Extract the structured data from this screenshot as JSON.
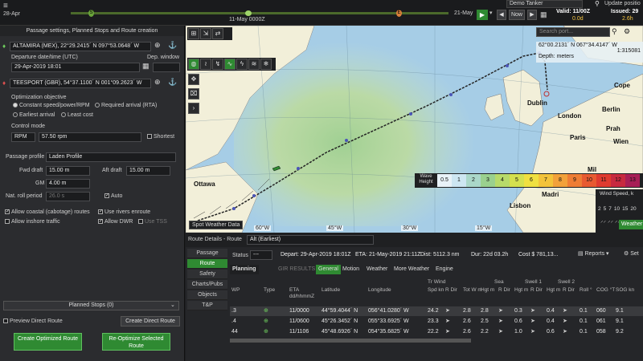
{
  "topbar": {
    "start_date": "28-Apr",
    "mid_date": "11-May 0000Z",
    "end_date": "21-May",
    "marker_start": "S",
    "marker_end": "E",
    "vessel": "Demo Tanker",
    "now_label": "Now",
    "update_label": "Update positio",
    "valid_label": "Valid: 11/00Z",
    "valid_sub": "0.0d",
    "issued_label": "Issued: 29",
    "issued_sub": "2.6h",
    "hamburger": "≡"
  },
  "left": {
    "header": "Passage settings, Planned Stops and Route creation",
    "departure_port": "ALTAMIRA (MEX), 22°29.2415´ N 097°53.0648´ W",
    "departure_label": "Departure date/time (UTC)",
    "dep_window_label": "Dep. window",
    "departure_datetime": "29-Apr-2019 18:01",
    "arrival_port": "TEESPORT (GBR), 54°37.1100´ N 001°09.2623´ W",
    "opt_label": "Optimization objective",
    "opt_constant": "Constant speed/power/RPM",
    "opt_rta": "Required arrival (RTA)",
    "opt_earliest": "Earliest arrival",
    "opt_least": "Least cost",
    "control_label": "Control mode",
    "control_mode": "RPM",
    "rpm_value": "57.50 rpm",
    "shortest": "Shortest",
    "profile_label": "Passage profile",
    "profile_value": "Laden Profile",
    "fwd_label": "Fwd draft",
    "fwd_value": "15.00 m",
    "aft_label": "Aft draft",
    "aft_value": "15.00 m",
    "gm_label": "GM",
    "gm_value": "4.00 m",
    "roll_label": "Nat. roll period",
    "roll_value": "26.0 s",
    "auto_label": "Auto",
    "cabotage": "Allow coastal (cabotage) routes",
    "rivers": "Use rivers enroute",
    "inshore": "Allow inshore traffic",
    "dwr": "Allow DWR",
    "tss": "Use TSS",
    "planned_stops": "Planned Stops (0)",
    "preview_direct": "Preview Direct Route",
    "create_direct": "Create Direct Route",
    "create_optimized": "Create Optimized Route",
    "reoptimize": "Re-Optimize Selected Route"
  },
  "map": {
    "search_placeholder": "Search port...",
    "coords": "62°00.2131´ N  067°34.4147´ W",
    "scale": "1:315081",
    "depth": "Depth: meters",
    "places": [
      "Ottawa",
      "Dublin",
      "London",
      "Berlin",
      "Paris",
      "Prah",
      "Wien",
      "Madri",
      "Lisbon",
      "Mil",
      "Cope"
    ],
    "lon_labels": [
      "60°W",
      "45°W",
      "30°W",
      "15°W"
    ],
    "spot_weather": "Spot Weather Data",
    "wave_label": "Wave Height",
    "wave_scale": [
      "0.5",
      "1",
      "2",
      "3",
      "4",
      "5",
      "6",
      "7",
      "8",
      "9",
      "10",
      "11",
      "12",
      "13"
    ],
    "wave_colors": [
      "#e8f2f8",
      "#cde6f2",
      "#aad7c9",
      "#9ad08e",
      "#b7da6a",
      "#d4e04e",
      "#f0e040",
      "#f3c33a",
      "#f2a13a",
      "#ee7d35",
      "#e85a30",
      "#df3b2f",
      "#c72a3f",
      "#a71f55"
    ],
    "wind_label": "Wind Speed, k",
    "wind_scale": [
      "2",
      "5",
      "7",
      "10",
      "15",
      "20"
    ],
    "weather_label": "Weather"
  },
  "route": {
    "title": "Route Details - Route",
    "route_name": "Alt (Earliest)",
    "status_label": "Status",
    "status_value": "---",
    "depart": "Depart: 29-Apr-2019 18:01Z",
    "eta": "ETA: 21-May-2019 21:11Z",
    "dist": "Dist: 5112.3 nm",
    "dur": "Dur: 22d 03.2h",
    "cost": "Cost $ 781,13...",
    "reports": "Reports",
    "set": "Set",
    "side_tabs": [
      "Passage",
      "Route",
      "Safety",
      "Charts/Pubs",
      "Objects",
      "T&P"
    ],
    "tabs": [
      "Planning",
      "GIR RESULTS",
      "General",
      "Motion",
      "Weather",
      "More Weather",
      "Engine"
    ],
    "group_headers": [
      "Tr Wind",
      "Sea",
      "Swell 1",
      "Swell 2"
    ],
    "col_headers": [
      "WP",
      "Type",
      "ETA dd/hhmmZ",
      "Latitude",
      "Longitude",
      "Spd kn",
      "R Dir",
      "Tot W m",
      "Hgt m",
      "R Dir",
      "Hgt m",
      "R Dir",
      "Hgt m",
      "R Dir",
      "Roll °",
      "COG °T",
      "SOG kn"
    ],
    "rows": [
      {
        "wp": ".3",
        "eta": "11/0000",
        "lat": "44°59.4044´ N",
        "lon": "056°41.0280´ W",
        "spd": "24.2",
        "totw": "2.8",
        "sea": "2.8",
        "sw1": "0.3",
        "sw2": "0.4",
        "roll": "0.1",
        "cog": "060",
        "sog": "9.1"
      },
      {
        "wp": ".4",
        "eta": "11/0600",
        "lat": "45°26.3452´ N",
        "lon": "055°33.6925´ W",
        "spd": "23.3",
        "totw": "2.6",
        "sea": "2.5",
        "sw1": "0.6",
        "sw2": "0.4",
        "roll": "0.1",
        "cog": "061",
        "sog": "9.1"
      },
      {
        "wp": "44",
        "eta": "11/1106",
        "lat": "45°48.6926´ N",
        "lon": "054°35.6825´ W",
        "spd": "22.2",
        "totw": "2.6",
        "sea": "2.2",
        "sw1": "1.0",
        "sw2": "0.6",
        "roll": "0.1",
        "cog": "058",
        "sog": "9.2"
      }
    ]
  },
  "colors": {
    "accent_green": "#2f8a32",
    "panel": "#2b2c2f",
    "route_line": "#111111"
  }
}
